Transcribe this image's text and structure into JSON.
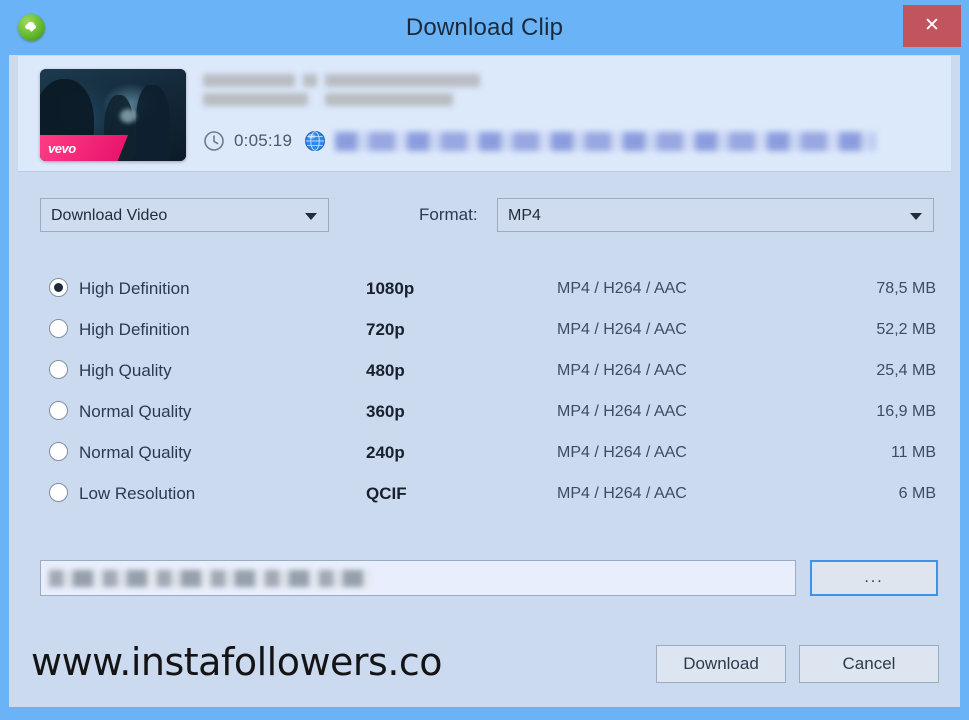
{
  "window": {
    "title": "Download Clip",
    "app_icon": "download-cloud-icon",
    "close_label": "✕",
    "titlebar_color": "#6bb3f7",
    "close_button_color": "#c1545c",
    "body_color": "#ccdaf0",
    "info_panel_color": "#dce9fb"
  },
  "info": {
    "thumbnail_badge": "vevo",
    "clock_icon": "clock-icon",
    "duration": "0:05:19",
    "globe_icon": "globe-icon",
    "title_redacted": true,
    "url_redacted": true
  },
  "selectors": {
    "download_type": "Download Video",
    "format_label": "Format:",
    "format_value": "MP4",
    "dropdown_icon": "chevron-down-icon"
  },
  "quality_table": {
    "selected_index": 0,
    "rows": [
      {
        "name": "High Definition",
        "resolution": "1080p",
        "codec": "MP4 / H264 / AAC",
        "size": "78,5 MB",
        "selected": true
      },
      {
        "name": "High Definition",
        "resolution": "720p",
        "codec": "MP4 / H264 / AAC",
        "size": "52,2 MB",
        "selected": false
      },
      {
        "name": "High Quality",
        "resolution": "480p",
        "codec": "MP4 / H264 / AAC",
        "size": "25,4 MB",
        "selected": false
      },
      {
        "name": "Normal Quality",
        "resolution": "360p",
        "codec": "MP4 / H264 / AAC",
        "size": "16,9 MB",
        "selected": false
      },
      {
        "name": "Normal Quality",
        "resolution": "240p",
        "codec": "MP4 / H264 / AAC",
        "size": "11 MB",
        "selected": false
      },
      {
        "name": "Low Resolution",
        "resolution": "QCIF",
        "codec": "MP4 / H264 / AAC",
        "size": "6 MB",
        "selected": false
      }
    ]
  },
  "path": {
    "value_redacted": true,
    "browse_label": "..."
  },
  "footer": {
    "download_label": "Download",
    "cancel_label": "Cancel"
  },
  "watermark": {
    "text": "www.instafollowers.co"
  }
}
